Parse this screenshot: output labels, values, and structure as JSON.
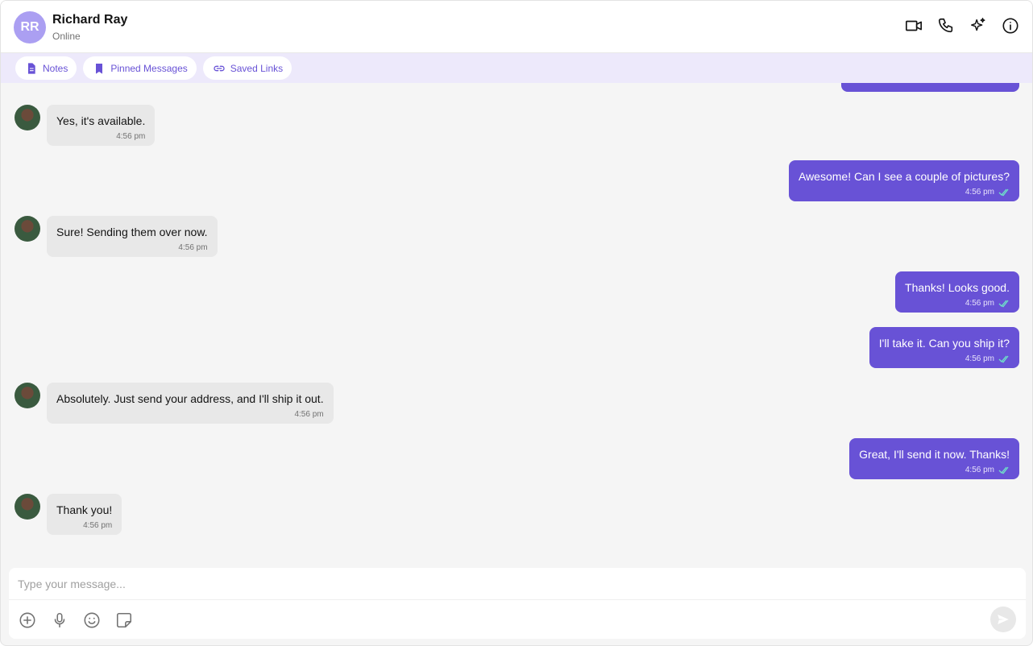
{
  "header": {
    "initials": "RR",
    "name": "Richard Ray",
    "status": "Online",
    "actions": [
      "video-call-icon",
      "voice-call-icon",
      "ai-sparkle-icon",
      "info-icon"
    ]
  },
  "tabs": [
    {
      "label": "Notes",
      "icon": "note-icon"
    },
    {
      "label": "Pinned Messages",
      "icon": "bookmark-icon"
    },
    {
      "label": "Saved Links",
      "icon": "link-icon"
    }
  ],
  "messages": [
    {
      "dir": "in",
      "text": "Yes, it's available.",
      "time": "4:56 pm"
    },
    {
      "dir": "out",
      "text": "Awesome! Can I see a couple of pictures?",
      "time": "4:56 pm",
      "read": true
    },
    {
      "dir": "in",
      "text": "Sure! Sending them over now.",
      "time": "4:56 pm"
    },
    {
      "dir": "out",
      "text": "Thanks! Looks good.",
      "time": "4:56 pm",
      "read": true
    },
    {
      "dir": "out",
      "text": "I'll take it. Can you ship it?",
      "time": "4:56 pm",
      "read": true
    },
    {
      "dir": "in",
      "text": "Absolutely. Just send your address, and I'll ship it out.",
      "time": "4:56 pm"
    },
    {
      "dir": "out",
      "text": "Great, I'll send it now. Thanks!",
      "time": "4:56 pm",
      "read": true
    },
    {
      "dir": "in",
      "text": "Thank you!",
      "time": "4:56 pm"
    }
  ],
  "composer": {
    "placeholder": "Type your message...",
    "tools": [
      "add-icon",
      "microphone-icon",
      "emoji-icon",
      "sticker-icon"
    ],
    "send_icon": "send-icon"
  },
  "colors": {
    "accent": "#6852d6",
    "avatar_bg": "#ab9ff2",
    "tabs_bg": "#ede9fb",
    "incoming_bubble": "#e8e8e8",
    "read_tick": "#6fe3c8"
  }
}
